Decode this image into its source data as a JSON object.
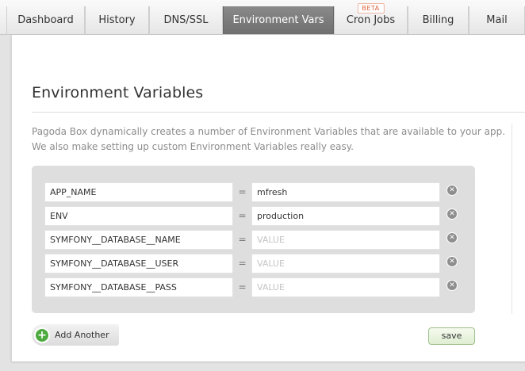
{
  "tabs": [
    {
      "label": "Dashboard",
      "active": false
    },
    {
      "label": "History",
      "active": false
    },
    {
      "label": "DNS/SSL",
      "active": false
    },
    {
      "label": "Environment Vars",
      "active": true
    },
    {
      "label": "Cron Jobs",
      "active": false,
      "badge": "BETA"
    },
    {
      "label": "Billing",
      "active": false
    },
    {
      "label": "Mail",
      "active": false
    }
  ],
  "page": {
    "title": "Environment Variables",
    "description_line1": "Pagoda Box dynamically creates a number of Environment Variables that are available to your app.",
    "description_line2": "We also make setting up custom Environment Variables really easy."
  },
  "variables": {
    "equals": "=",
    "rows": [
      {
        "key": "APP_NAME",
        "value": "mfresh",
        "placeholder": "VALUE"
      },
      {
        "key": "ENV",
        "value": "production",
        "placeholder": "VALUE"
      },
      {
        "key": "SYMFONY__DATABASE__NAME",
        "value": "",
        "placeholder": "VALUE"
      },
      {
        "key": "SYMFONY__DATABASE__USER",
        "value": "",
        "placeholder": "VALUE"
      },
      {
        "key": "SYMFONY__DATABASE__PASS",
        "value": "",
        "placeholder": "VALUE"
      }
    ]
  },
  "actions": {
    "add_label": "Add Another",
    "add_icon": "plus-circle-icon",
    "save_label": "save",
    "remove_icon": "close-circle-icon"
  }
}
